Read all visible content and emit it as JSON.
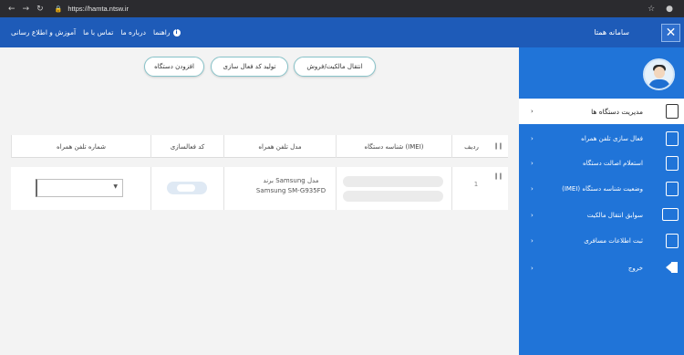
{
  "browser": {
    "url": "https://hamta.ntsw.ir",
    "back_icon": "arrow-left-icon",
    "forward_icon": "arrow-right-icon",
    "reload_icon": "reload-icon",
    "star_icon": "star-icon",
    "account_icon": "account-icon"
  },
  "header": {
    "brand": "سامانه همتا",
    "close_icon": "close-icon",
    "nav": [
      {
        "label": "راهنما"
      },
      {
        "label": "درباره ما"
      },
      {
        "label": "تماس با ما"
      },
      {
        "label": "آموزش و اطلاع رسانی"
      }
    ]
  },
  "sidebar": {
    "items": [
      {
        "label": "مدیریت دستگاه ها",
        "icon": "mobile-device-icon",
        "chev": "›"
      },
      {
        "label": "فعال سازی تلفن همراه",
        "icon": "phone-download-icon",
        "chev": "›"
      },
      {
        "label": "استعلام اصالت دستگاه",
        "icon": "phone-search-icon",
        "chev": "›"
      },
      {
        "label": "وضعیت شناسه دستگاه (IMEI)",
        "icon": "phone-status-icon",
        "chev": "›"
      },
      {
        "label": "سوابق انتقال مالکیت",
        "icon": "transfer-icon",
        "chev": "›"
      },
      {
        "label": "ثبت اطلاعات مسافری",
        "icon": "phone-plus-icon",
        "chev": "›"
      },
      {
        "label": "خروج",
        "icon": "exit-icon",
        "chev": "›"
      }
    ]
  },
  "actions": {
    "add_device": "افزودن دستگاه",
    "generate_code": "تولید کد فعال سازی",
    "transfer_ownership": "انتقال مالکیت/فروش"
  },
  "table": {
    "columns": {
      "row": "ردیف",
      "imei": "شناسه دستگاه (IMEI)",
      "model": "مدل تلفن همراه",
      "activation_code": "کد فعالسازی",
      "phone_number": "شماره تلفن همراه"
    },
    "rows": [
      {
        "row": "1",
        "brand_line": "برند Samsung مدل",
        "model_line": "Samsung SM-G935FD"
      }
    ]
  }
}
